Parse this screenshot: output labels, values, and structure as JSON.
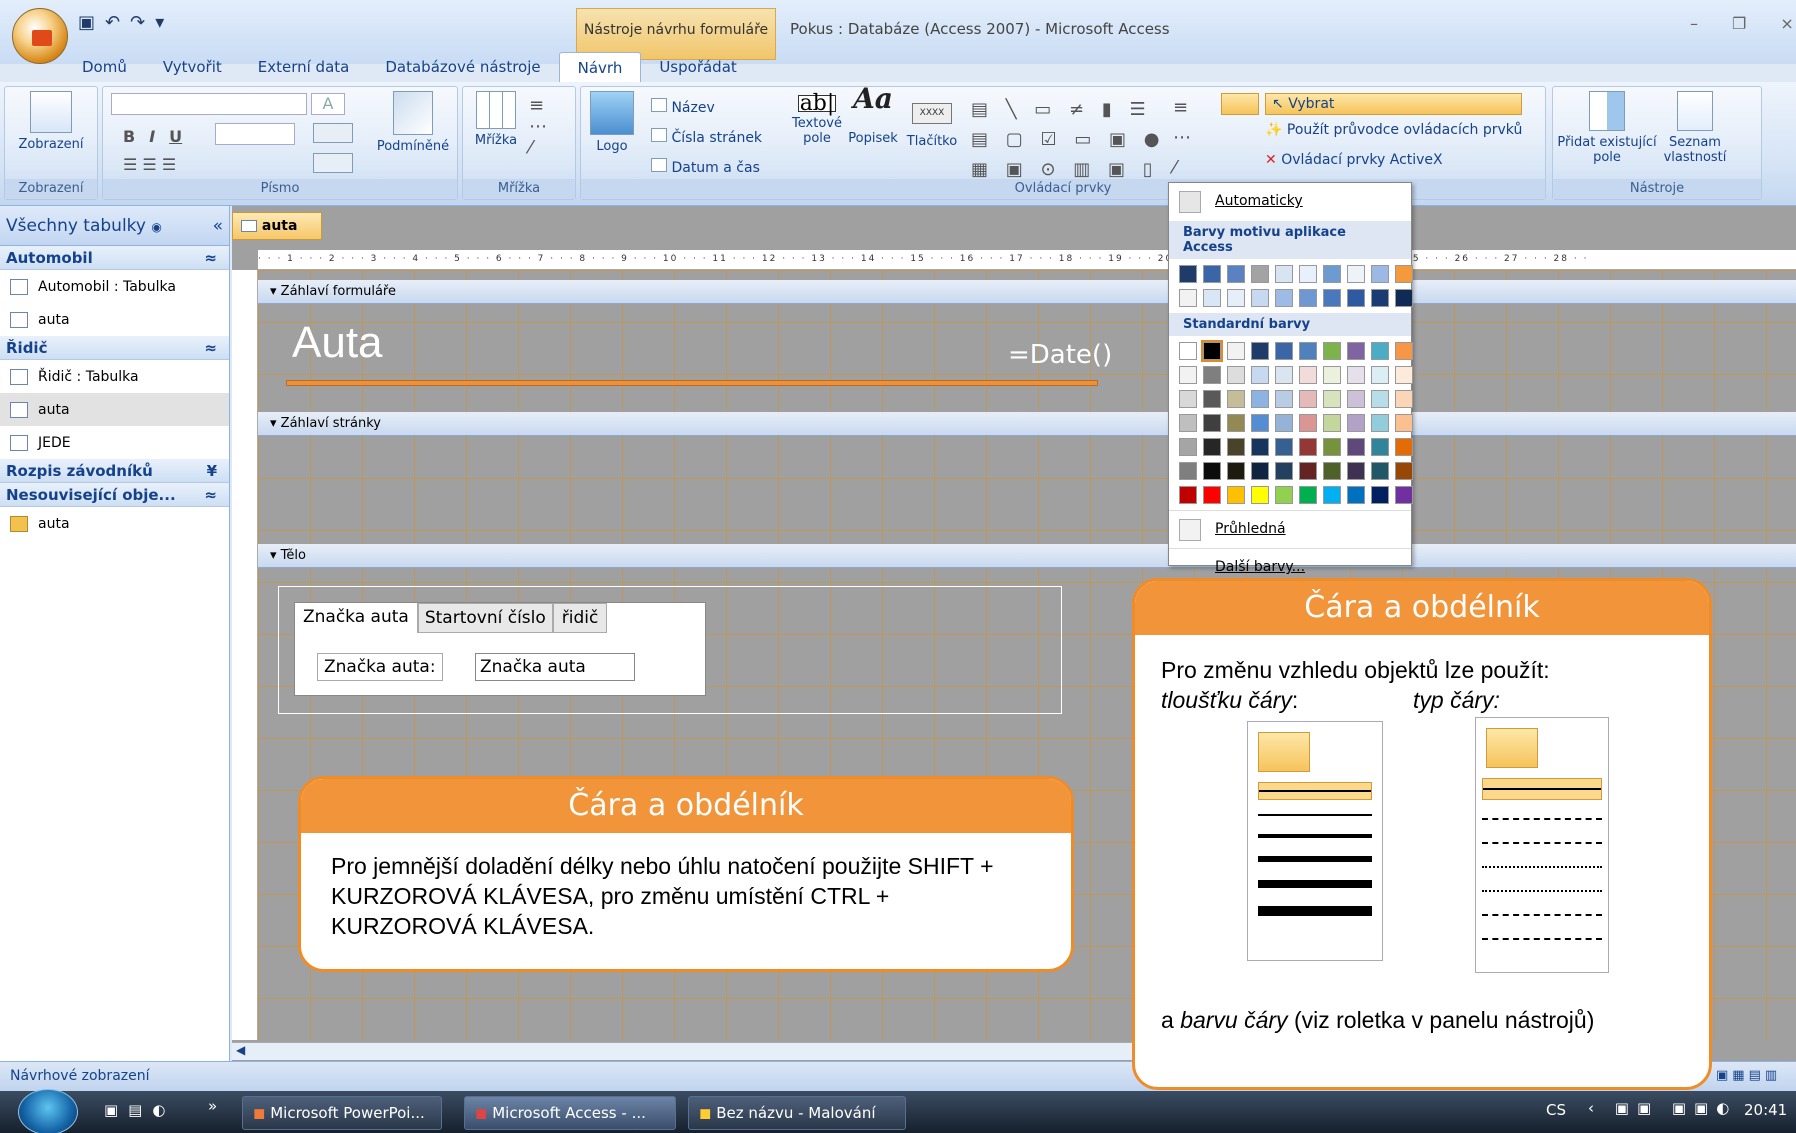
{
  "window": {
    "title": "Pokus : Databáze (Access 2007) - Microsoft Access",
    "context_tab": "Nástroje návrhu formuláře"
  },
  "ribbon_tabs": [
    "Domů",
    "Vytvořit",
    "Externí data",
    "Databázové nástroje",
    "Návrh",
    "Uspořádat"
  ],
  "ribbon": {
    "groups": {
      "zobrazeni": "Zobrazení",
      "pismo": "Písmo",
      "mrizka": "Mřížka",
      "ovladaci": "Ovládací prvky",
      "nastroje": "Nástroje"
    },
    "buttons": {
      "zobrazeni": "Zobrazení",
      "podminene": "Podmíněné",
      "mrizka": "Mřížka",
      "logo": "Logo",
      "nazev": "Název",
      "cisla_stranek": "Čísla stránek",
      "datum_cas": "Datum a čas",
      "textove_pole": "Textové pole",
      "popisek": "Popisek",
      "tlacitko": "Tlačítko",
      "vybrat": "Vybrat",
      "pruvodce": "Použít průvodce ovládacích prvků",
      "activex": "Ovládací prvky ActiveX",
      "pridat_pole": "Přidat existující pole",
      "seznam_vlastnosti": "Seznam vlastností",
      "bold": "B",
      "italic": "I",
      "underline": "U",
      "ab_icon": "ab|",
      "aa_icon": "Aa",
      "xxxx_icon": "XXXX"
    }
  },
  "nav": {
    "header": "Všechny tabulky",
    "groups": [
      {
        "label": "Automobil",
        "chev": "≈",
        "items": [
          {
            "label": "Automobil : Tabulka",
            "icon": "table-icon"
          },
          {
            "label": "auta",
            "icon": "form-icon"
          }
        ]
      },
      {
        "label": "Řidič",
        "chev": "≈",
        "items": [
          {
            "label": "Řidič : Tabulka",
            "icon": "table-icon"
          },
          {
            "label": "auta",
            "icon": "form-icon"
          },
          {
            "label": "JEDE",
            "icon": "form-icon"
          }
        ]
      },
      {
        "label": "Rozpis závodníků",
        "chev": "¥",
        "items": []
      },
      {
        "label": "Nesouvisející obje...",
        "chev": "≈",
        "items": [
          {
            "label": "auta",
            "icon": "report-icon"
          }
        ]
      }
    ]
  },
  "document": {
    "tab": "auta",
    "sections": {
      "header": "Záhlaví formuláře",
      "page_header": "Záhlaví stránky",
      "body": "Tělo"
    },
    "form_title": "Auta",
    "date_field": "=Date()",
    "tabs": [
      "Značka auta",
      "Startovní číslo",
      "řidič"
    ],
    "label": "Značka auta:",
    "field": "Značka auta"
  },
  "color_popup": {
    "automatic": "Automaticky",
    "theme_header": "Barvy motivu aplikace Access",
    "standard_header": "Standardní barvy",
    "transparent": "Průhledná",
    "more": "Další barvy...",
    "theme_colors": [
      "#1f3b6a",
      "#3a66a8",
      "#5a82c0",
      "#a3a3a3",
      "#d9e4f3",
      "#e8f0fb",
      "#6c9bd2",
      "#eef3f8",
      "#9bb9e3",
      "#f39a3c",
      "#f2f2f2",
      "#d9e6f8",
      "#e6eef9",
      "#c6d9f1",
      "#9dbbe4",
      "#6f98d2",
      "#4a78bd",
      "#2d5aa0",
      "#1a3c73",
      "#0f2a55"
    ],
    "standard_colors": [
      [
        "#ffffff",
        "#000000",
        "#f2f2f2",
        "#1f3b6a",
        "#3a66a8",
        "#4f81bd",
        "#7db34b",
        "#8064a2",
        "#4bacc6",
        "#f79646"
      ],
      [
        "#f2f2f2",
        "#7f7f7f",
        "#dddddd",
        "#c6d9f0",
        "#dbe5f1",
        "#f2dcdb",
        "#ebf1dd",
        "#e5e0ec",
        "#dbeef3",
        "#fdeada"
      ],
      [
        "#d8d8d8",
        "#595959",
        "#c4bd97",
        "#8db3e2",
        "#b8cce4",
        "#e5b9b7",
        "#d7e3bc",
        "#ccc1d9",
        "#b7dde8",
        "#fbd5b5"
      ],
      [
        "#bfbfbf",
        "#3f3f3f",
        "#938953",
        "#548dd4",
        "#95b3d7",
        "#d99694",
        "#c3d69b",
        "#b2a2c7",
        "#92cddc",
        "#fac08f"
      ],
      [
        "#a5a5a5",
        "#262626",
        "#494429",
        "#17365d",
        "#366092",
        "#953734",
        "#76923c",
        "#5f497a",
        "#31859b",
        "#e36c09"
      ],
      [
        "#7f7f7f",
        "#0c0c0c",
        "#1d1b10",
        "#0f243e",
        "#244061",
        "#632423",
        "#4f6128",
        "#3f3151",
        "#205867",
        "#974806"
      ],
      [
        "#c00000",
        "#ff0000",
        "#ffc000",
        "#ffff00",
        "#92d050",
        "#00b050",
        "#00b0f0",
        "#0070c0",
        "#002060",
        "#7030a0"
      ]
    ]
  },
  "callout_right": {
    "title": "Čára a obdélník",
    "line1": "Pro změnu vzhledu objektů lze použít:",
    "thickness": "tloušťku čáry",
    "thickness_colon": ":",
    "type": "typ čáry:",
    "bottom_a": "a ",
    "bottom_color": "barvu čáry",
    "bottom_rest": " (viz roletka v panelu nástrojů)"
  },
  "callout_left": {
    "title": "Čára a obdélník",
    "text": "Pro jemnější doladění délky nebo úhlu natočení použijte SHIFT + KURZOROVÁ KLÁVESA, pro změnu umístění CTRL + KURZOROVÁ KLÁVESA."
  },
  "status": {
    "left": "Návrhové zobrazení"
  },
  "taskbar": {
    "items": [
      "Microsoft PowerPoi...",
      "Microsoft Access - ...",
      "Bez názvu - Malování"
    ],
    "lang": "CS",
    "time": "20:41",
    "arrows": "»"
  },
  "ruler": {
    "text": "· · · 1 · · · 2 · · · 3 · · · 4 · · · 5 · · · 6 · · · 7 · · · 8 · · · 9 · · · 10 · · · 11 · · · 12 · · · 13 · · · 14 · · · 15 · · · 16 · · · 17 · · · 18 · · · 19 · · · 20 · · · 21 · · · 22 · · · 23 · · · 24 · · · 25 · · · 26 · · · 27 · · · 28 · ·"
  },
  "glyphs": {
    "close": "×",
    "minimize": "–",
    "restore": "❐",
    "collapse": "«",
    "chevdown": "▾",
    "dropdown": "▾",
    "scroll_right": "▶",
    "scroll_left": "◀",
    "section_arrow": "▾"
  }
}
